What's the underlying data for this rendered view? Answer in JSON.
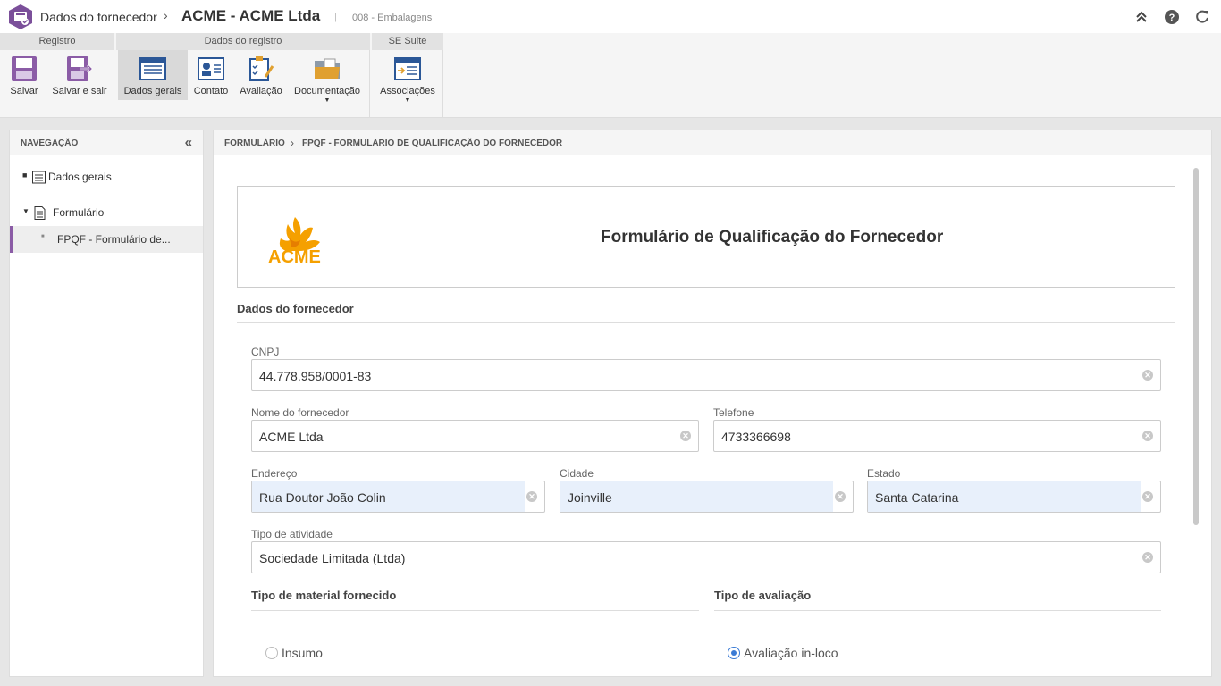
{
  "titlebar": {
    "section": "Dados do fornecedor",
    "title": "ACME - ACME Ltda",
    "separator": "|",
    "subtitle": "008 - Embalagens",
    "icons": [
      "collapse-up-icon",
      "help-icon",
      "refresh-icon"
    ]
  },
  "ribbon": {
    "groups": [
      {
        "title": "Registro",
        "buttons": [
          {
            "label": "Salvar",
            "icon": "save-icon"
          },
          {
            "label": "Salvar e sair",
            "icon": "save-exit-icon"
          }
        ]
      },
      {
        "title": "Dados do registro",
        "buttons": [
          {
            "label": "Dados gerais",
            "icon": "general-data-icon"
          },
          {
            "label": "Contato",
            "icon": "contact-icon"
          },
          {
            "label": "Avaliação",
            "icon": "evaluation-icon"
          },
          {
            "label": "Documentação",
            "icon": "documentation-icon"
          }
        ]
      },
      {
        "title": "SE Suite",
        "buttons": [
          {
            "label": "Associações",
            "icon": "associations-icon"
          }
        ]
      }
    ]
  },
  "nav": {
    "title": "NAVEGAÇÃO",
    "items": [
      {
        "label": "Dados gerais"
      },
      {
        "label": "Formulário"
      },
      {
        "label": "FPQF - Formulário de..."
      }
    ]
  },
  "breadcrumb": {
    "root": "FORMULÁRIO",
    "current": "FPQF - FORMULARIO DE QUALIFICAÇÃO DO FORNECEDOR"
  },
  "form": {
    "title": "Formulário de Qualificação do Fornecedor",
    "logo_text": "ACME",
    "section_supplier": "Dados do fornecedor",
    "fields": {
      "cnpj": {
        "label": "CNPJ",
        "value": "44.778.958/0001-83"
      },
      "nome": {
        "label": "Nome do fornecedor",
        "value": "ACME Ltda"
      },
      "telefone": {
        "label": "Telefone",
        "value": "4733366698"
      },
      "endereco": {
        "label": "Endereço",
        "value": "Rua Doutor João Colin"
      },
      "cidade": {
        "label": "Cidade",
        "value": "Joinville"
      },
      "estado": {
        "label": "Estado",
        "value": "Santa Catarina"
      },
      "atividade": {
        "label": "Tipo de atividade",
        "value": "Sociedade Limitada (Ltda)"
      }
    },
    "material_section": "Tipo de material fornecido",
    "evaluation_section": "Tipo de avaliação",
    "material_options": [
      {
        "label": "Insumo",
        "selected": false
      }
    ],
    "evaluation_options": [
      {
        "label": "Avaliação in-loco",
        "selected": true
      }
    ]
  },
  "colors": {
    "brand": "#8b5ca6",
    "accent": "#3a7bd5",
    "logo": "#f5a000"
  }
}
